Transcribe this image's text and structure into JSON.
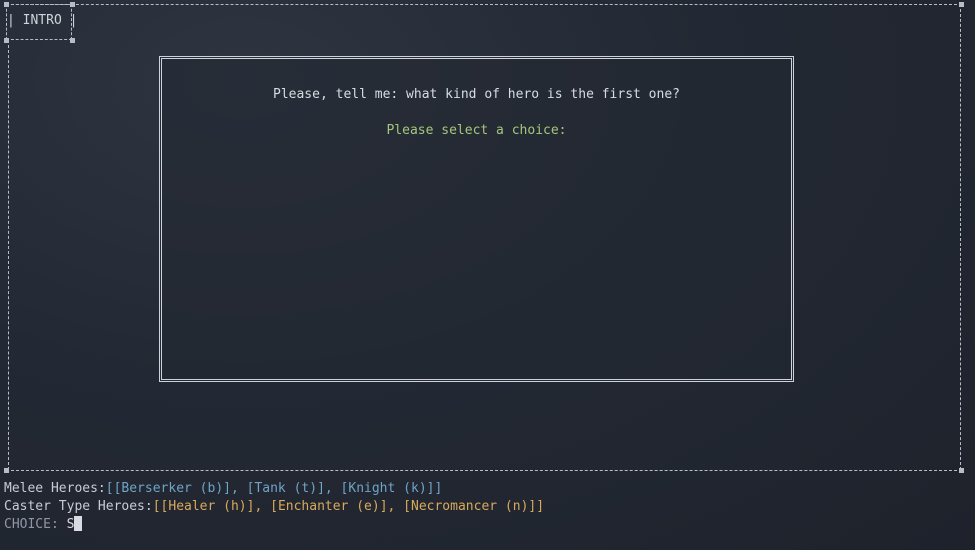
{
  "tab": {
    "label": "| INTRO |"
  },
  "dialog": {
    "question": "Please, tell me: what kind of hero is the first one?",
    "prompt": "Please select a choice:"
  },
  "console": {
    "melee_label": "Melee Heroes:",
    "melee_options": "[[Berserker (b)], [Tank (t)], [Knight (k)]]",
    "caster_label": "Caster Type Heroes:",
    "caster_options": "[[Healer (h)], [Enchanter (e)], [Necromancer (n)]]",
    "choice_label": "CHOICE: ",
    "choice_value": "S"
  },
  "colors": {
    "prompt": "#a3c77d",
    "melee": "#6fa4c6",
    "caster": "#d9a95c",
    "choice_label": "#8f96a5"
  }
}
